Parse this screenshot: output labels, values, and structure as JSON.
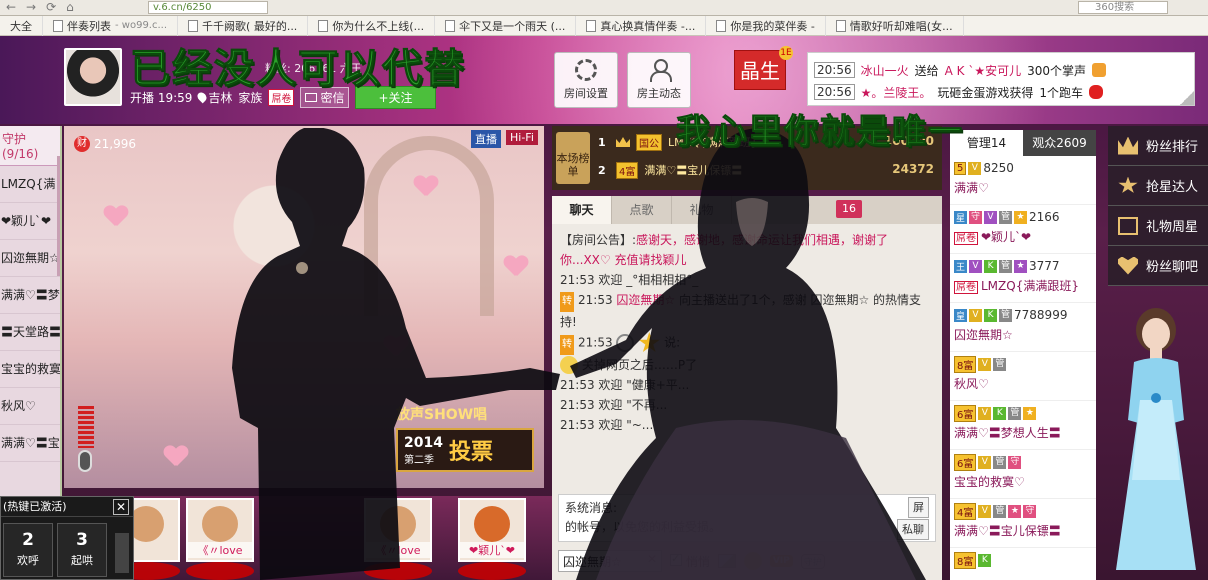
{
  "browser": {
    "url": "v.6.cn/6250",
    "search_placeholder": "360搜索",
    "bookmarks": [
      {
        "label": "大全"
      },
      {
        "label": "伴奏列表",
        "ext": "- wo99.c..."
      },
      {
        "label": "千千阙歌( 最好的..."
      },
      {
        "label": "你为什么不上线(..."
      },
      {
        "label": "伞下又是一个雨天 (..."
      },
      {
        "label": "真心换真情伴奏 -..."
      },
      {
        "label": "你是我的菜伴奏 -"
      },
      {
        "label": "情歌好听却难唱(女..."
      }
    ]
  },
  "overlay": {
    "title_top": "已经没人可以代替",
    "title_mid": "我心里你就是唯一"
  },
  "anchor": {
    "fans_text": "粉丝: 206761 六王",
    "start_label": "开播 19:59",
    "location": "吉林",
    "family_label": "家族",
    "family_badge": "屌卷",
    "message_label": "密信",
    "follow_label": "+关注"
  },
  "room_buttons": {
    "settings": "房间设置",
    "owner_news": "房主动态"
  },
  "crystal": {
    "label": "晶生",
    "level": "1E"
  },
  "gift_feed": [
    {
      "time": "20:56",
      "user": "冰山一火",
      "action": "送给",
      "target": "A K `★安可儿",
      "detail": "300个掌声"
    },
    {
      "time": "20:56",
      "user": "★。兰陵王。",
      "action": "玩砸金蛋游戏获得",
      "target": "",
      "detail": "1个跑车"
    }
  ],
  "guardians": {
    "header": "守护(9/16)",
    "items": [
      "LMZQ{满",
      "❤颖儿`❤",
      "囚迩無期☆",
      "满满♡〓梦",
      "〓天堂路〓",
      "宝宝的救寞",
      "秋风♡",
      "满满♡〓宝"
    ]
  },
  "video": {
    "wealth": "21,996",
    "wealth_icon": "财",
    "live_tag": "直播",
    "hifi_tag": "Hi-Fi",
    "vote_top": "放声SHOW唱",
    "vote_year": "2014",
    "vote_season": "第二季",
    "vote_label": "投票"
  },
  "rank": {
    "tag": "本场榜单",
    "rows": [
      {
        "num": "1",
        "level": "国公",
        "name": "LMZQ{满满跟班}",
        "score": "100000"
      },
      {
        "num": "2",
        "level": "4富",
        "name": "满满♡〓宝儿保镖〓",
        "score": "24372"
      }
    ]
  },
  "chat": {
    "tabs": [
      "聊天",
      "点歌",
      "礼物"
    ],
    "count": "16",
    "notice_label": "【房间公告】:",
    "notice_text": "感谢天，感谢地，感谢命运让我们相遇，谢谢了你...XX♡ 充值请找颖儿",
    "lines": [
      {
        "tag": "",
        "time": "21:53",
        "text": "欢迎 _°相相相相°_"
      },
      {
        "tag": "转",
        "time": "21:53",
        "user": "囚迩無期☆",
        "text": "向主播送出了1个，感谢 囚迩無期☆ 的热情支持!"
      },
      {
        "tag": "转",
        "time": "21:53",
        "text": "说:"
      },
      {
        "tag": "",
        "time": "",
        "text": "关掉网页之后……P了"
      },
      {
        "tag": "",
        "time": "21:53",
        "text": "欢迎 \"健康+平..."
      },
      {
        "tag": "",
        "time": "21:53",
        "text": "欢迎 \"不再..."
      },
      {
        "tag": "",
        "time": "21:53",
        "text": "欢迎 \"~..."
      }
    ],
    "sys_label": "系统消息:",
    "sys_text": "的帐号，以免您的利益受损。",
    "screen_btn": "屏",
    "private_btn": "私聊",
    "target_value": "囚迩無期☆",
    "quiet_label": "悄悄"
  },
  "audience": {
    "tab_admin": "管理14",
    "tab_viewers": "观众2609",
    "items": [
      {
        "level": "5",
        "value": "8250",
        "badge": "",
        "name": "满满♡"
      },
      {
        "level": "",
        "value": "2166",
        "badge": "屌卷",
        "name": "❤颖儿`❤"
      },
      {
        "level": "",
        "value": "3777",
        "badge": "屌卷",
        "name": "LMZQ{满满跟班}"
      },
      {
        "level": "",
        "value": "7788999",
        "badge": "",
        "name": "囚迩無期☆"
      },
      {
        "level": "8富",
        "value": "",
        "badge": "",
        "name": "秋风♡"
      },
      {
        "level": "6富",
        "value": "",
        "badge": "",
        "name": "满满♡〓梦想人生〓"
      },
      {
        "level": "6富",
        "value": "",
        "badge": "",
        "name": "宝宝的救寞♡"
      },
      {
        "level": "4富",
        "value": "",
        "badge": "",
        "name": "满满♡〓宝儿保镖〓"
      },
      {
        "level": "8富",
        "value": "",
        "badge": "",
        "name": ""
      }
    ]
  },
  "right_menu": [
    "粉丝排行",
    "抢星达人",
    "礼物周星",
    "粉丝聊吧"
  ],
  "thumbs": [
    {
      "label": ""
    },
    {
      "label": "《〃love"
    },
    {
      "label": "《〃love"
    },
    {
      "label": "❤颖儿`❤"
    }
  ],
  "hotkey": {
    "title": "(热键已激活)",
    "buttons": [
      {
        "num": "2",
        "label": "欢呼"
      },
      {
        "num": "3",
        "label": "起哄"
      }
    ]
  }
}
